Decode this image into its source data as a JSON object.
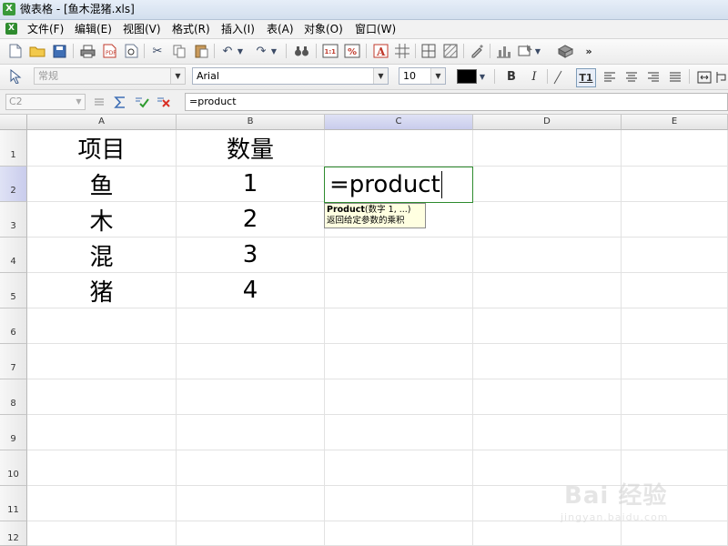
{
  "window": {
    "title": "微表格 - [鱼木混猪.xls]"
  },
  "menu": [
    "文件(F)",
    "编辑(E)",
    "视图(V)",
    "格式(R)",
    "插入(I)",
    "表(A)",
    "对象(O)",
    "窗口(W)"
  ],
  "toolbar2": {
    "style": "常规",
    "font": "Arial",
    "size": "10",
    "bold": "B",
    "italic": "I",
    "text_style": "T1"
  },
  "formula_bar": {
    "cell_ref": "C2",
    "formula": "=product"
  },
  "grid": {
    "columns": [
      "A",
      "B",
      "C",
      "D",
      "E"
    ],
    "rows": [
      "1",
      "2",
      "3",
      "4",
      "5",
      "6",
      "7",
      "8",
      "9",
      "10",
      "11",
      "12"
    ],
    "cells": {
      "A1": "项目",
      "B1": "数量",
      "A2": "鱼",
      "B2": "1",
      "C2": "=product",
      "A3": "木",
      "B3": "2",
      "A4": "混",
      "B4": "3",
      "A5": "猪",
      "B5": "4"
    }
  },
  "tooltip": {
    "function_name": "Product",
    "signature": "(数字 1, ...)",
    "description": "返回给定参数的乘积"
  },
  "watermark": {
    "text": "Bai 经验",
    "sub": "jingyan.baidu.com"
  }
}
